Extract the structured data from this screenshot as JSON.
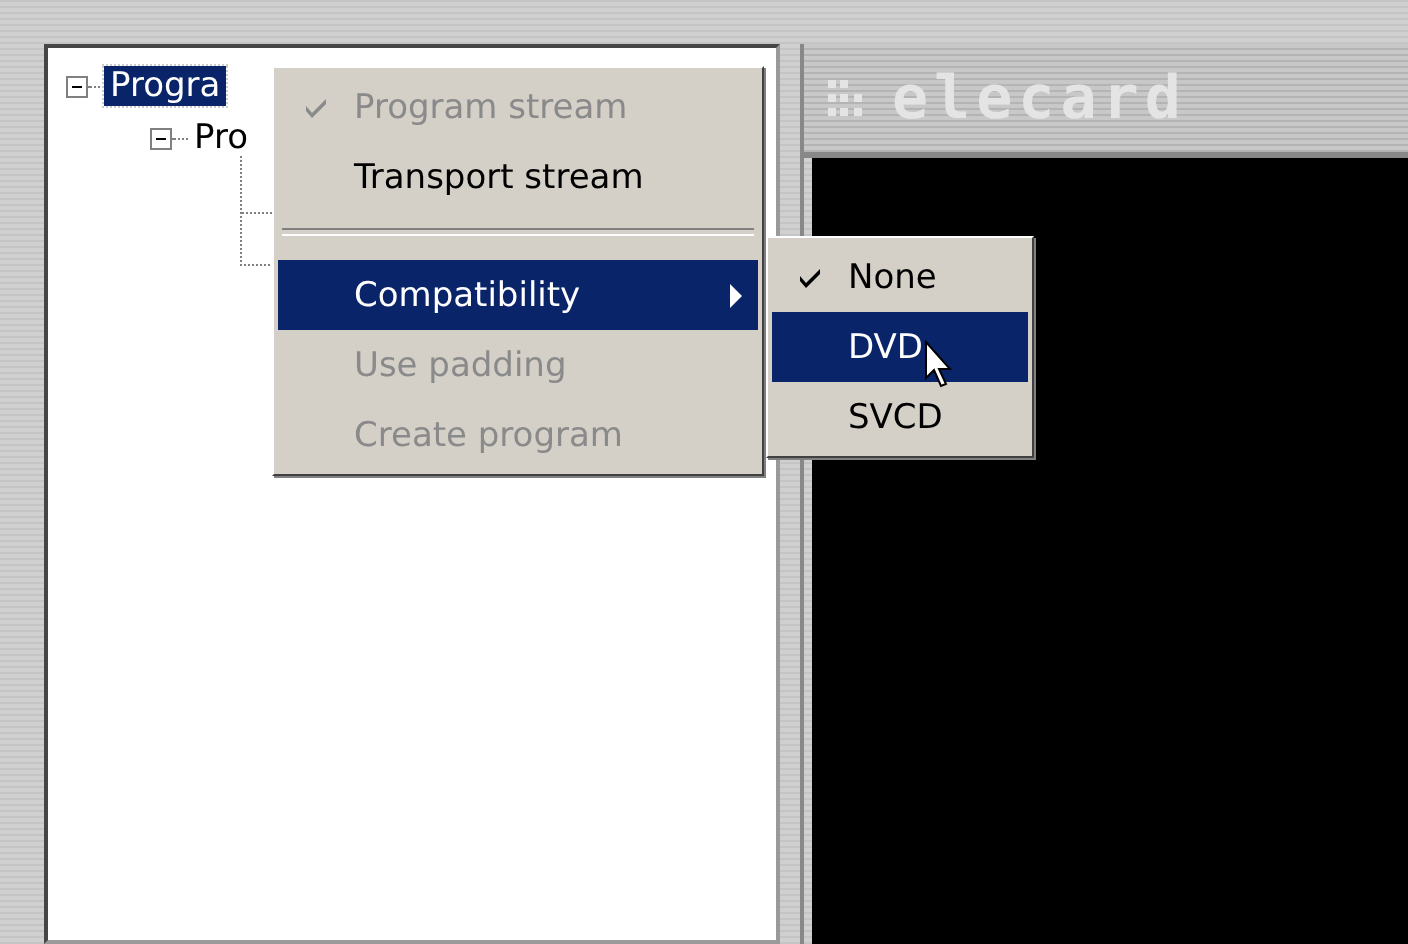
{
  "tree": {
    "items": [
      {
        "label": "Progra",
        "selected": true,
        "expanded": true,
        "children": [
          {
            "label": "Pro",
            "selected": false,
            "expanded": true
          }
        ]
      }
    ]
  },
  "video": {
    "logo": "elecard"
  },
  "menu": {
    "items": [
      {
        "kind": "item",
        "label": "Program stream",
        "disabled": true,
        "checked": true,
        "selected": false
      },
      {
        "kind": "item",
        "label": "Transport stream",
        "disabled": false,
        "checked": false,
        "selected": false
      },
      {
        "kind": "separator"
      },
      {
        "kind": "submenu",
        "label": "Compatibility",
        "disabled": false,
        "checked": false,
        "selected": true
      },
      {
        "kind": "item",
        "label": "Use padding",
        "disabled": true,
        "checked": false,
        "selected": false
      },
      {
        "kind": "item",
        "label": "Create program",
        "disabled": true,
        "checked": false,
        "selected": false
      }
    ]
  },
  "submenu": {
    "items": [
      {
        "label": "None",
        "checked": true,
        "selected": false
      },
      {
        "label": "DVD",
        "checked": false,
        "selected": true
      },
      {
        "label": "SVCD",
        "checked": false,
        "selected": false
      }
    ]
  }
}
